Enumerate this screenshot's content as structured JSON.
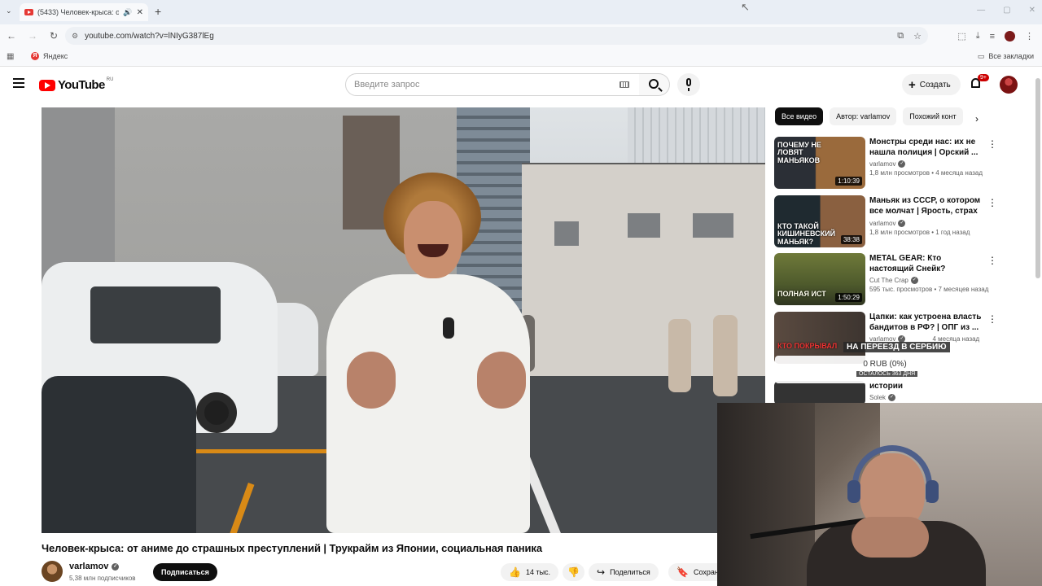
{
  "browser": {
    "tab_title": "(5433) Человек-крыса: от",
    "url": "youtube.com/watch?v=lNIyG387lEg",
    "bookmarks": {
      "yandex": "Яндекс",
      "all": "Все закладки"
    }
  },
  "youtube": {
    "logo_text": "YouTube",
    "region": "RU",
    "search_placeholder": "Введите запрос",
    "create_label": "Создать",
    "notifications_badge": "9+"
  },
  "video": {
    "title": "Человек-крыса: от аниме до страшных преступлений | Трукрайм из Японии, социальная паника",
    "channel": "varlamov",
    "subscribers": "5,38 млн подписчиков",
    "subscribe_label": "Подписаться",
    "likes": "14 тыс.",
    "share_label": "Поделиться",
    "save_label": "Сохран"
  },
  "sidebar": {
    "chips": [
      "Все видео",
      "Автор: varlamov",
      "Похожий конт"
    ],
    "recommendations": [
      {
        "title": "Монстры среди нас: их не нашла полиция | Орский ...",
        "channel": "varlamov",
        "meta": "1,8 млн просмотров • 4 месяца назад",
        "duration": "1:10:39",
        "thumb_text": "Почему не ловят маньяков"
      },
      {
        "title": "Маньяк из СССР, о котором все молчат | Ярость, страх и ...",
        "channel": "varlamov",
        "meta": "1,8 млн просмотров • 1 год назад",
        "duration": "38:38",
        "thumb_text": "Кто такой кишиневский маньяк?"
      },
      {
        "title": "METAL GEAR: Кто настоящий Снейк?",
        "channel": "Cut The Crap",
        "meta": "595 тыс. просмотров • 7 месяцев назад",
        "duration": "1:50:29",
        "thumb_text": "Полная ист"
      },
      {
        "title": "Цапки: как устроена власть бандитов в РФ? | ОПГ из ...",
        "channel": "varlamov",
        "meta": "4 месяца назад",
        "duration": "",
        "thumb_text": "Кто покрывал"
      },
      {
        "title": "истории",
        "channel": "Solek",
        "meta": "",
        "duration": "",
        "thumb_text": ""
      }
    ]
  },
  "overlay": {
    "donation_title": "На переезд в Сербию",
    "donation_amount": "0 RUB (0%)",
    "donation_days": "Осталось 363 дня"
  }
}
